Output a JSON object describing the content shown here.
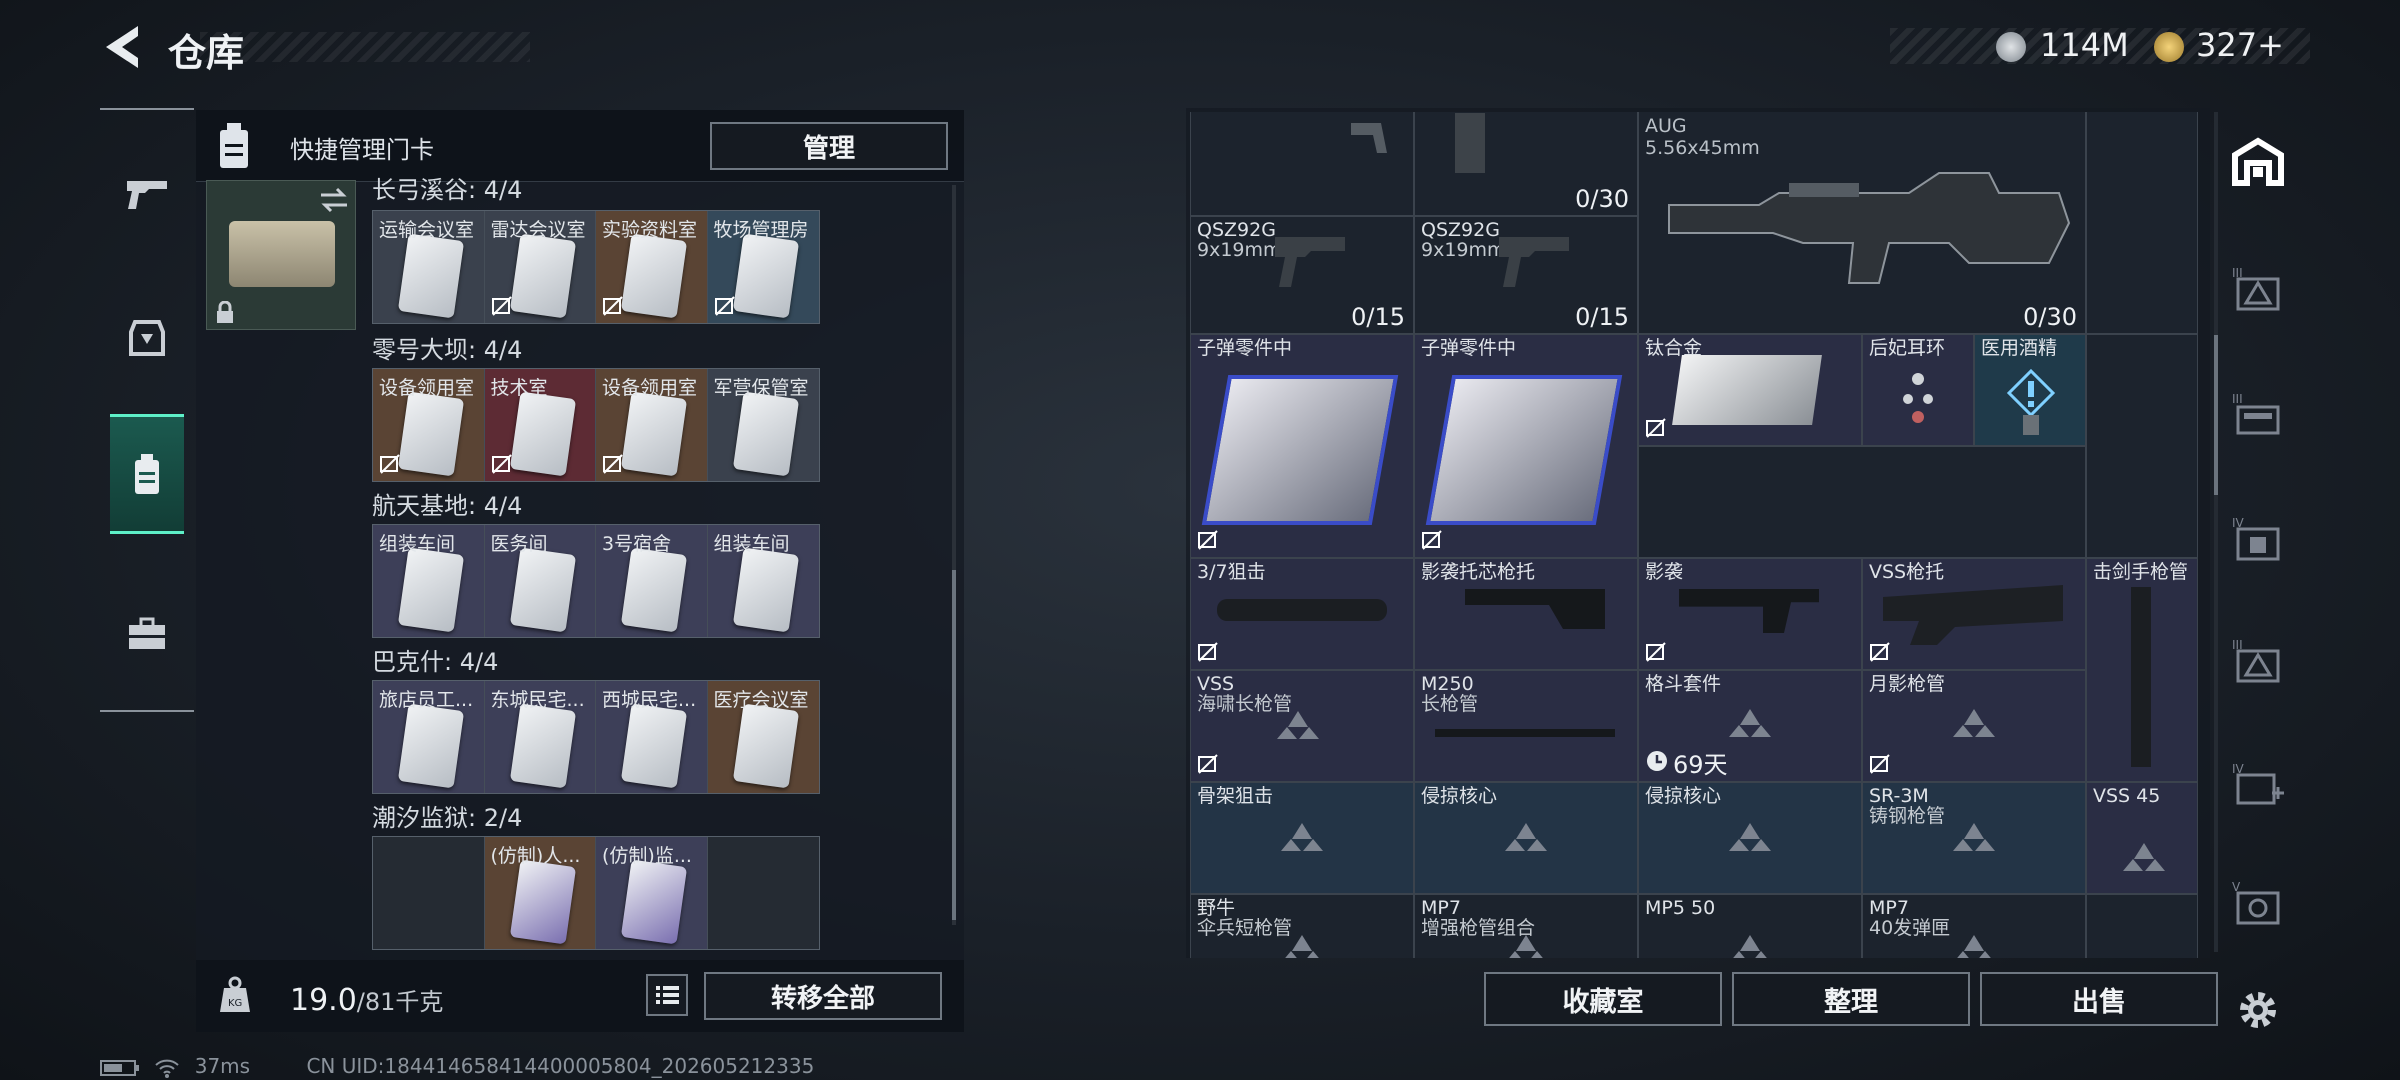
{
  "header": {
    "title": "仓库"
  },
  "currency": {
    "coins": "114M",
    "tickets": "327+"
  },
  "left_panel": {
    "header_title": "快捷管理门卡",
    "manage_label": "管理",
    "sections": [
      {
        "title": "长弓溪谷: 4/4",
        "cards": [
          "运输会议室",
          "雷达会议室",
          "实验资料室",
          "牧场管理房"
        ]
      },
      {
        "title": "零号大坝: 4/4",
        "cards": [
          "设备领用室",
          "技术室",
          "设备领用室",
          "军营保管室"
        ]
      },
      {
        "title": "航天基地: 4/4",
        "cards": [
          "组装车间",
          "医务间",
          "3号宿舍",
          "组装车间"
        ]
      },
      {
        "title": "巴克什: 4/4",
        "cards": [
          "旅店员工...",
          "东城民宅...",
          "西城民宅...",
          "医疗会议室"
        ]
      },
      {
        "title": "潮汐监狱: 2/4",
        "cards": [
          "",
          "(仿制)人...",
          "(仿制)监...",
          ""
        ]
      }
    ],
    "weight": "19.0",
    "weight_cap": "/81千克",
    "transfer_label": "转移全部"
  },
  "grid": {
    "aug_name": "AUG",
    "aug_ammo": "5.56x45mm",
    "aug_count": "0/30",
    "top_count": "0/30",
    "qsz1_name": "QSZ92G",
    "qsz1_ammo": "9x19mm",
    "qsz1_count": "0/15",
    "qsz2_name": "QSZ92G",
    "qsz2_ammo": "9x19mm",
    "qsz2_count": "0/15",
    "parts1": "子弹零件中",
    "parts2": "子弹零件中",
    "titanium": "钛合金",
    "earring": "后妃耳环",
    "alcohol": "医用酒精",
    "scope": "3/7狙击",
    "stock1": "影袭托芯枪托",
    "stock2": "影袭",
    "vss_stock": "VSS枪托",
    "handguard": "击剑手枪管",
    "vss_name": "VSS",
    "vss_sub": "海啸长枪管",
    "m250_name": "M250",
    "m250_sub": "长枪管",
    "grip": "格斗套件",
    "grip_timer": "69天",
    "moon": "月影枪管",
    "r6a": "骨架狙击",
    "r6b": "侵掠核心",
    "r6c": "侵掠核心",
    "r6d": "SR-3M",
    "r6d_sub": "铸钢枪管",
    "r6e": "VSS 45",
    "r7a": "野牛",
    "r7a_sub": "伞兵短枪管",
    "r7b": "MP7",
    "r7b_sub": "增强枪管组合",
    "r7c": "MP5 50",
    "r7d": "MP7",
    "r7d_sub": "40发弹匣"
  },
  "buttons": {
    "collection": "收藏室",
    "organize": "整理",
    "sell": "出售"
  },
  "status": {
    "ping": "37ms",
    "uid": "CN UID:184414658414400005804_202605212335"
  }
}
